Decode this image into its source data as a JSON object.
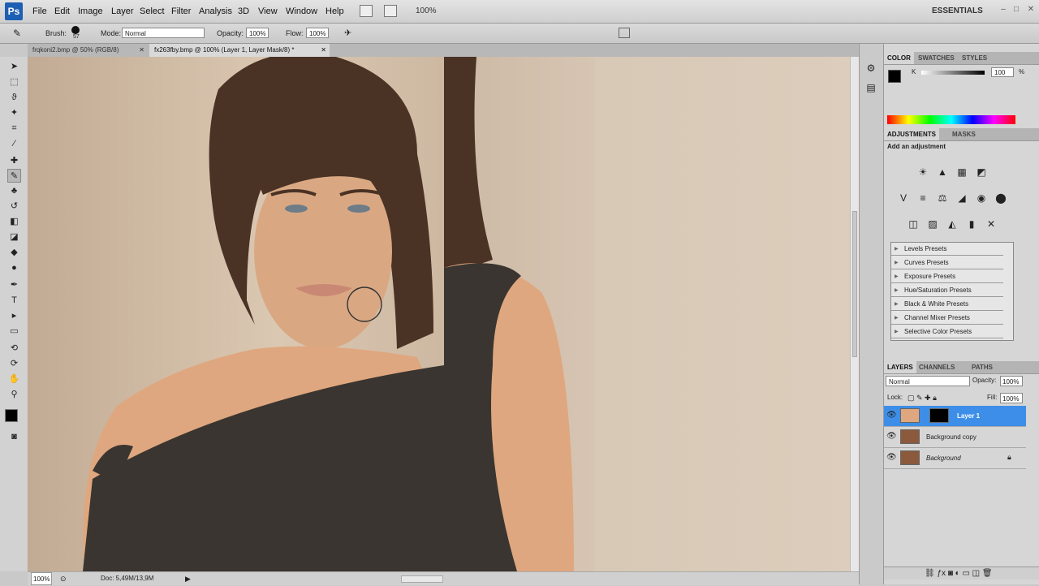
{
  "app": {
    "logo": "Ps",
    "workspace": "ESSENTIALS",
    "zoom_menu": "100%"
  },
  "menu": [
    "File",
    "Edit",
    "Image",
    "Layer",
    "Select",
    "Filter",
    "Analysis",
    "3D",
    "View",
    "Window",
    "Help"
  ],
  "options": {
    "brush_label": "Brush:",
    "brush_size": "57",
    "mode_label": "Mode:",
    "mode_value": "Normal",
    "opacity_label": "Opacity:",
    "opacity_value": "100%",
    "flow_label": "Flow:",
    "flow_value": "100%"
  },
  "doc_tabs": [
    {
      "label": "frqkoni2.bmp @ 50% (RGB/8)"
    },
    {
      "label": "fx263fby.bmp @ 100% (Layer 1, Layer Mask/8) *"
    }
  ],
  "status": {
    "zoom": "100%",
    "doc": "Doc: 5,49M/13,9M"
  },
  "color_panel": {
    "tabs": [
      "COLOR",
      "SWATCHES",
      "STYLES"
    ],
    "channel": "K",
    "value": "100",
    "unit": "%"
  },
  "adjustments": {
    "tabs": [
      "ADJUSTMENTS",
      "MASKS"
    ],
    "heading": "Add an adjustment",
    "presets": [
      "Levels Presets",
      "Curves Presets",
      "Exposure Presets",
      "Hue/Saturation Presets",
      "Black & White Presets",
      "Channel Mixer Presets",
      "Selective Color Presets"
    ]
  },
  "layers_panel": {
    "tabs": [
      "LAYERS",
      "CHANNELS",
      "PATHS"
    ],
    "blend_mode": "Normal",
    "opacity_label": "Opacity:",
    "opacity_value": "100%",
    "lock_label": "Lock:",
    "fill_label": "Fill:",
    "fill_value": "100%",
    "layers": [
      {
        "name": "Layer 1",
        "selected": true
      },
      {
        "name": "Background copy",
        "selected": false
      },
      {
        "name": "Background",
        "selected": false
      }
    ]
  },
  "colors": {
    "accent": "#3d8ee8",
    "ps_blue": "#1d5fb3"
  }
}
